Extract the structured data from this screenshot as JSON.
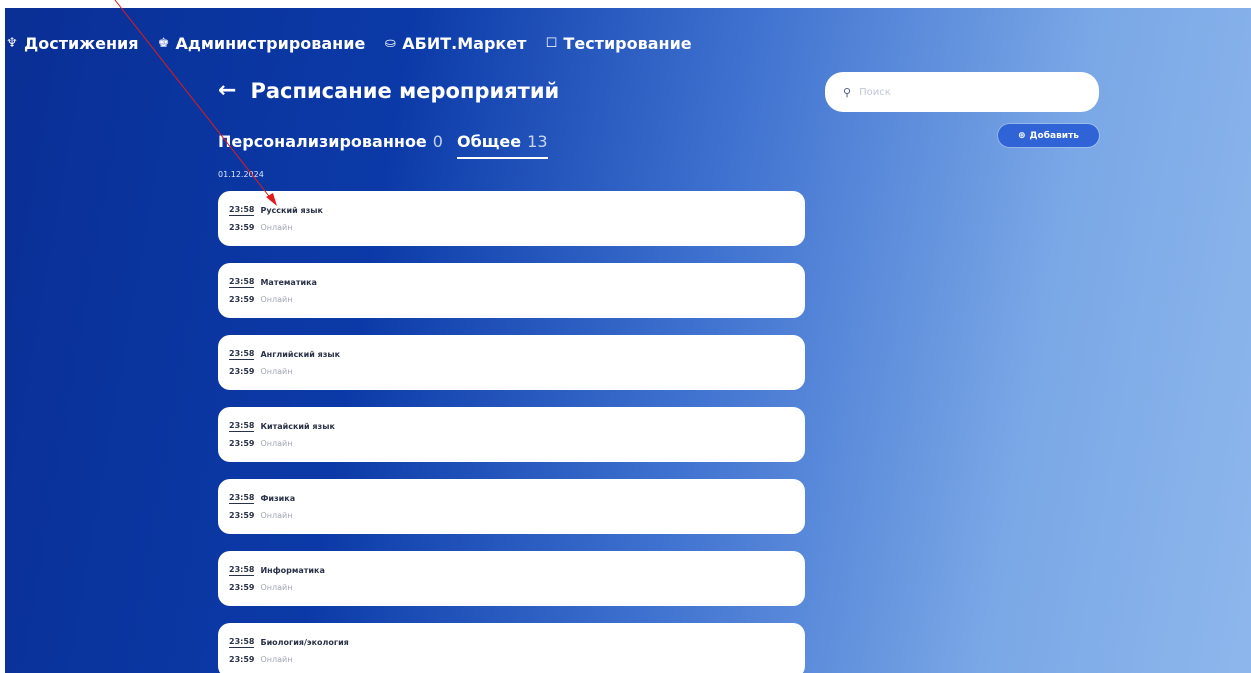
{
  "nav": {
    "items": [
      {
        "label": "Достижения",
        "icon": "trophy-icon",
        "glyph": "♆"
      },
      {
        "label": "Администрирование",
        "icon": "admin-icon",
        "glyph": "♚"
      },
      {
        "label": "АБИТ.Маркет",
        "icon": "shop-icon",
        "glyph": "⛀"
      },
      {
        "label": "Тестирование",
        "icon": "test-icon",
        "glyph": "☐"
      }
    ]
  },
  "page": {
    "title": "Расписание мероприятий",
    "back_glyph": "←"
  },
  "search": {
    "placeholder": "Поиск",
    "icon_glyph": "⚲"
  },
  "add_button": {
    "label": "Добавить",
    "icon_glyph": "⊕"
  },
  "tabs": [
    {
      "label": "Персонализированное",
      "count": "0",
      "active": false
    },
    {
      "label": "Общее",
      "count": "13",
      "active": true
    }
  ],
  "date": "01.12.2024",
  "events": [
    {
      "start": "23:58",
      "end": "23:59",
      "name": "Русский язык",
      "type": "Онлайн"
    },
    {
      "start": "23:58",
      "end": "23:59",
      "name": "Математика",
      "type": "Онлайн"
    },
    {
      "start": "23:58",
      "end": "23:59",
      "name": "Английский язык",
      "type": "Онлайн"
    },
    {
      "start": "23:58",
      "end": "23:59",
      "name": "Китайский язык",
      "type": "Онлайн"
    },
    {
      "start": "23:58",
      "end": "23:59",
      "name": "Физика",
      "type": "Онлайн"
    },
    {
      "start": "23:58",
      "end": "23:59",
      "name": "Информатика",
      "type": "Онлайн"
    },
    {
      "start": "23:58",
      "end": "23:59",
      "name": "Биология/экология",
      "type": "Онлайн"
    }
  ],
  "colors": {
    "bg_start": "#0a2f95",
    "bg_end": "#8db7ec",
    "annotation_arrow": "#e11b1b"
  }
}
